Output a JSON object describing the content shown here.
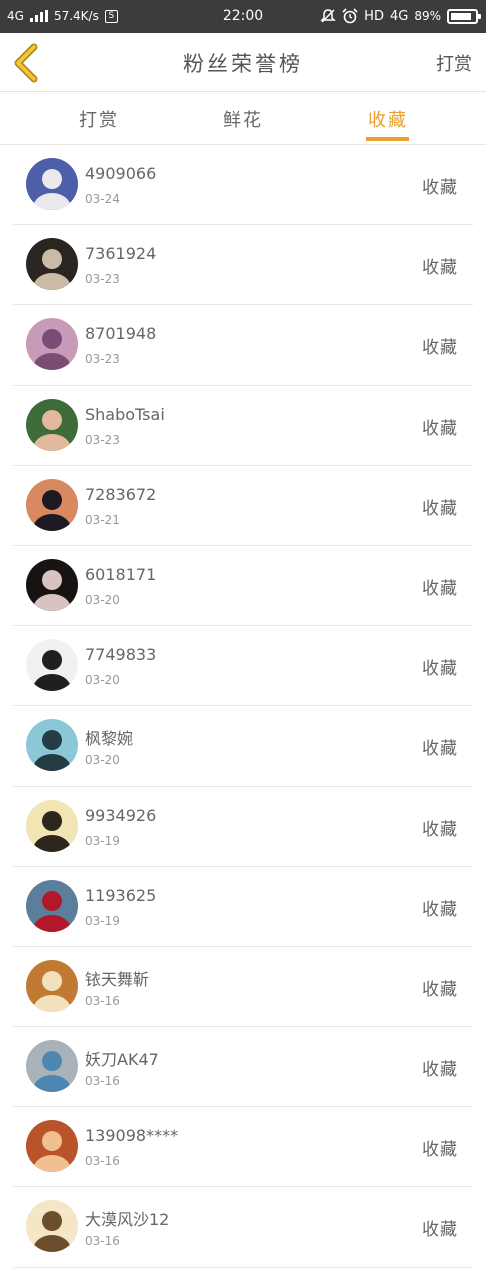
{
  "status_bar": {
    "network": "4G",
    "speed": "57.4K/s",
    "s_icon": "S",
    "time": "22:00",
    "hd": "HD",
    "network_right": "4G",
    "battery": "89%",
    "battery_level": 0.89
  },
  "nav": {
    "title": "粉丝荣誉榜",
    "right_action": "打赏",
    "back_icon": "chevron-left-icon",
    "accent": "#e8a12e"
  },
  "tabs": [
    {
      "label": "打赏",
      "active": false
    },
    {
      "label": "鲜花",
      "active": false
    },
    {
      "label": "收藏",
      "active": true
    }
  ],
  "list": [
    {
      "name": "4909066",
      "date": "03-24",
      "action": "收藏",
      "avatar_colors": [
        "#4d5fa8",
        "#e9e9ee"
      ]
    },
    {
      "name": "7361924",
      "date": "03-23",
      "action": "收藏",
      "avatar_colors": [
        "#2b2522",
        "#c9bba6"
      ]
    },
    {
      "name": "8701948",
      "date": "03-23",
      "action": "收藏",
      "avatar_colors": [
        "#c79bb8",
        "#7a4d74"
      ]
    },
    {
      "name": "ShaboTsai",
      "date": "03-23",
      "action": "收藏",
      "avatar_colors": [
        "#3f6a3a",
        "#e3b99d"
      ]
    },
    {
      "name": "7283672",
      "date": "03-21",
      "action": "收藏",
      "avatar_colors": [
        "#d9895f",
        "#1e1a24"
      ]
    },
    {
      "name": "6018171",
      "date": "03-20",
      "action": "收藏",
      "avatar_colors": [
        "#171312",
        "#d8c3c0"
      ]
    },
    {
      "name": "7749833",
      "date": "03-20",
      "action": "收藏",
      "avatar_colors": [
        "#f1f1f1",
        "#1f1f1f"
      ]
    },
    {
      "name": "枫黎婉",
      "date": "03-20",
      "action": "收藏",
      "avatar_colors": [
        "#8bc7d6",
        "#243c44"
      ]
    },
    {
      "name": "9934926",
      "date": "03-19",
      "action": "收藏",
      "avatar_colors": [
        "#f2e5b4",
        "#2c261d"
      ]
    },
    {
      "name": "1193625",
      "date": "03-19",
      "action": "收藏",
      "avatar_colors": [
        "#5b7f9a",
        "#b3182a"
      ]
    },
    {
      "name": "铱天舞靳",
      "date": "03-16",
      "action": "收藏",
      "avatar_colors": [
        "#c07a33",
        "#f3e1be"
      ]
    },
    {
      "name": "妖刀AK47",
      "date": "03-16",
      "action": "收藏",
      "avatar_colors": [
        "#a8b2b8",
        "#4e86b2"
      ]
    },
    {
      "name": "139098****",
      "date": "03-16",
      "action": "收藏",
      "avatar_colors": [
        "#b8532a",
        "#f0c090"
      ]
    },
    {
      "name": "大漠风沙12",
      "date": "03-16",
      "action": "收藏",
      "avatar_colors": [
        "#f5e7c6",
        "#6b4f2c"
      ]
    }
  ]
}
